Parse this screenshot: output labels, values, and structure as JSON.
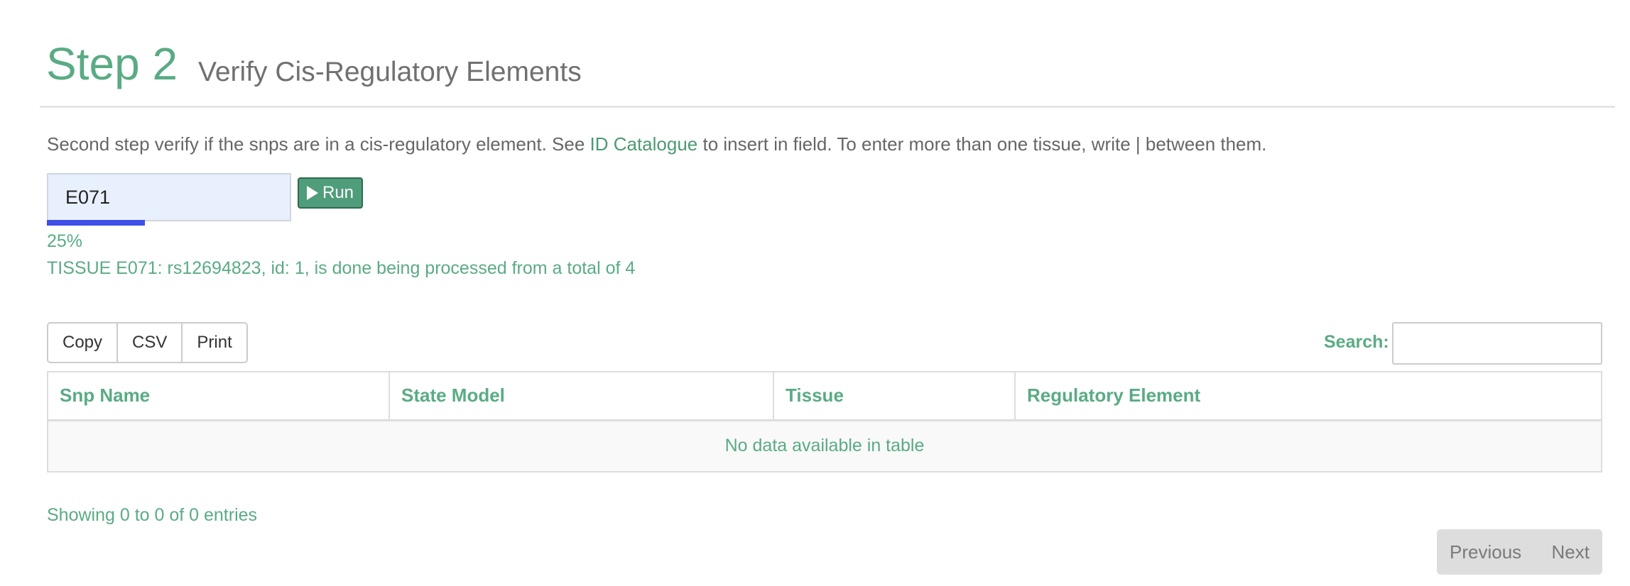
{
  "header": {
    "step": "Step 2",
    "subtitle": "Verify Cis-Regulatory Elements"
  },
  "intro": {
    "before": "Second step verify if the snps are in a cis-regulatory element. See ",
    "link": "ID Catalogue",
    "after": " to insert in field. To enter more than one tissue, write | between them."
  },
  "form": {
    "tissue_value": "E071",
    "run_label": "Run"
  },
  "progress": {
    "percent_value": 25,
    "percent_text": "25%",
    "status": "TISSUE E071: rs12694823, id: 1, is done being processed from a total of 4",
    "color": "#3f4fe8"
  },
  "toolbar": {
    "buttons": [
      "Copy",
      "CSV",
      "Print"
    ],
    "search_label": "Search:",
    "search_value": ""
  },
  "table": {
    "columns": [
      "Snp Name",
      "State Model",
      "Tissue",
      "Regulatory Element"
    ],
    "empty_message": "No data available in table"
  },
  "footer": {
    "info": "Showing 0 to 0 of 0 entries",
    "previous": "Previous",
    "next": "Next"
  },
  "colors": {
    "accent_green": "#5aab84",
    "run_button": "#4f9d7a",
    "input_bg": "#e8f0fd"
  },
  "icons": {
    "run": "play-icon"
  }
}
